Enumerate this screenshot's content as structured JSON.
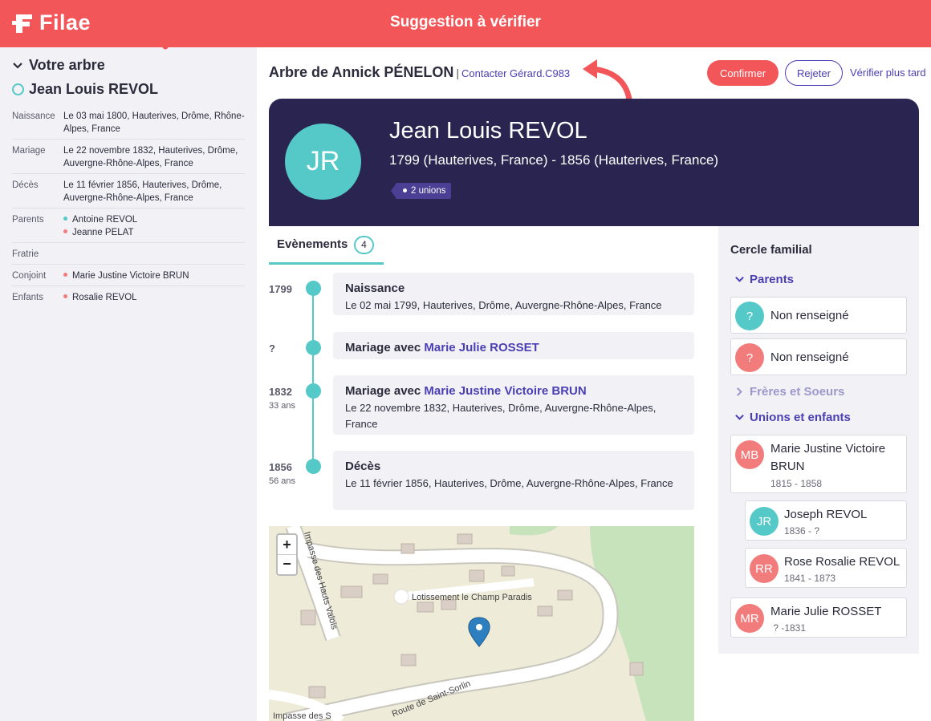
{
  "header": {
    "logo_text": "Filae",
    "title": "Suggestion à vérifier",
    "brand_color": "#f35658"
  },
  "sidebar": {
    "section_title": "Votre arbre",
    "person_name": "Jean Louis REVOL",
    "rows": [
      {
        "label": "Naissance",
        "value": "Le 03 mai 1800, Hauterives, Drôme, Rhône-Alpes, France"
      },
      {
        "label": "Mariage",
        "value": "Le 22 novembre 1832, Hauterives, Drôme, Auvergne-Rhône-Alpes, France"
      },
      {
        "label": "Décès",
        "value": "Le 11 février 1856, Hauterives, Drôme, Auvergne-Rhône-Alpes, France"
      },
      {
        "label": "Parents",
        "values": [
          "Antoine REVOL",
          "Jeanne PELAT"
        ]
      },
      {
        "label": "Fratrie",
        "value": ""
      },
      {
        "label": "Conjoint",
        "values": [
          "Marie Justine Victoire BRUN"
        ]
      },
      {
        "label": "Enfants",
        "values": [
          "Rosalie REVOL"
        ]
      }
    ]
  },
  "main": {
    "tree_title": "Arbre de Annick PÉNELON",
    "separator": "|",
    "contact_link": "Contacter Gérard.C983",
    "buttons": {
      "confirm": "Confirmer",
      "reject": "Rejeter",
      "later": "Vérifier plus tard"
    }
  },
  "hero": {
    "initials": "JR",
    "name": "Jean Louis REVOL",
    "dates": "1799 (Hauterives, France) - 1856 (Hauterives, France)",
    "unions_badge": "2 unions"
  },
  "tabs": [
    {
      "label": "Evènements",
      "count": "4"
    }
  ],
  "events": [
    {
      "year": "1799",
      "age": "",
      "title": "Naissance",
      "link": "",
      "detail": "Le 02 mai 1799, Hauterives, Drôme, Auvergne-Rhône-Alpes, France"
    },
    {
      "year": "?",
      "age": "",
      "title": "Mariage avec ",
      "link": "Marie Julie ROSSET",
      "detail": ""
    },
    {
      "year": "1832",
      "age": "33 ans",
      "title": "Mariage avec ",
      "link": "Marie Justine Victoire BRUN",
      "detail": "Le 22 novembre 1832, Hauterives, Drôme, Auvergne-Rhône-Alpes, France"
    },
    {
      "year": "1856",
      "age": "56 ans",
      "title": "Décès",
      "link": "",
      "detail": "Le 11 février 1856, Hauterives, Drôme, Auvergne-Rhône-Alpes, France"
    }
  ],
  "map": {
    "zoom_in": "+",
    "zoom_out": "−",
    "labels": [
      "Impasse des Hauts Valois",
      "Lotissement le Champ Paradis",
      "Route de Saint-Sorlin",
      "Impasse des S"
    ]
  },
  "family": {
    "title": "Cercle familial",
    "sections": {
      "parents": "Parents",
      "siblings": "Frères et Soeurs",
      "unions": "Unions et enfants"
    },
    "parents": [
      {
        "initials": "?",
        "name": "Non renseigné"
      },
      {
        "initials": "?",
        "name": "Non renseigné"
      }
    ],
    "unions": [
      {
        "initials": "MB",
        "name": "Marie Justine Victoire BRUN",
        "years": "1815 - 1858",
        "children": [
          {
            "initials": "JR",
            "name": "Joseph REVOL",
            "years": "1836 - ?"
          },
          {
            "initials": "RR",
            "name": "Rose Rosalie REVOL",
            "years": "1841 - 1873"
          }
        ]
      },
      {
        "initials": "MR",
        "name": "Marie Julie ROSSET",
        "years": " ? -1831"
      }
    ]
  }
}
